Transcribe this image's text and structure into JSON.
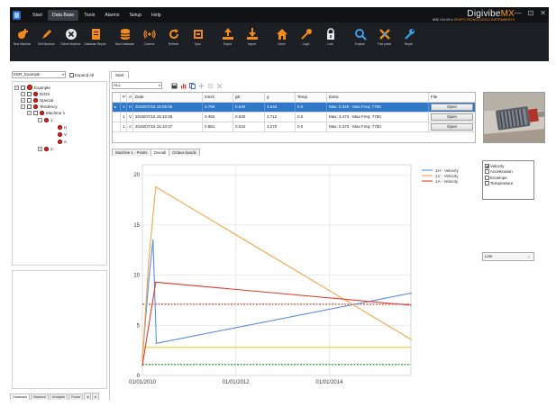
{
  "titlebar": {
    "menu": [
      "Start",
      "Data Base",
      "Tools",
      "Alarms",
      "Setup",
      "Help"
    ],
    "active_menu": "Data Base",
    "brand_name": "DigivibeMX",
    "brand_version": "M30 V10.09.4",
    "brand_maker": "GRUPO TECNOLOGICO INSTRUMENTS",
    "window_buttons": [
      "—",
      "⊡",
      "✕"
    ]
  },
  "ribbon": {
    "buttons": [
      {
        "label": "New Machine",
        "icon": "new-machine-icon"
      },
      {
        "label": "Edit Machine",
        "icon": "edit-pencil-icon"
      },
      {
        "label": "Delete Machine",
        "icon": "delete-circle-icon"
      },
      {
        "label": "Database Report",
        "icon": "database-report-icon"
      },
      {
        "label": "New Database",
        "icon": "new-database-icon"
      },
      {
        "label": "Connect",
        "icon": "connect-wireless-icon"
      },
      {
        "label": "Refresh",
        "icon": "refresh-icon"
      },
      {
        "label": "Sync",
        "icon": "sync-document-icon"
      },
      {
        "label": "Export",
        "icon": "export-icon"
      },
      {
        "label": "Import",
        "icon": "import-icon"
      },
      {
        "label": "Home",
        "icon": "home-icon"
      },
      {
        "label": "Login",
        "icon": "key-icon"
      },
      {
        "label": "Lock",
        "icon": "lock-icon"
      },
      {
        "label": "Explore",
        "icon": "search-icon"
      },
      {
        "label": "Free plane",
        "icon": "free-plane-icon"
      },
      {
        "label": "Repair",
        "icon": "wrench-icon"
      }
    ]
  },
  "left_panel": {
    "db_combo": "EDR_Example",
    "expand_all": "Expand All",
    "expand_all_checked": false,
    "tree": [
      {
        "label": "Example",
        "level": 0
      },
      {
        "label": "IDOS",
        "level": 1
      },
      {
        "label": "Special",
        "level": 1
      },
      {
        "label": "Tendency",
        "level": 1
      },
      {
        "label": "Machine 1",
        "level": 2
      },
      {
        "label": "1",
        "level": 3
      },
      {
        "label": "H",
        "level": 4
      },
      {
        "label": "V",
        "level": 4
      },
      {
        "label": "A",
        "level": 4
      },
      {
        "label": "2",
        "level": 3
      }
    ],
    "bottom_tabs": [
      "Database",
      "Balance",
      "Analysis",
      "Route",
      "◂",
      "▸"
    ]
  },
  "main": {
    "doc_tab": "Start",
    "filter_combo": "ALL",
    "grid": {
      "columns": [
        "P",
        "A",
        "Date",
        "mm/s",
        "gE",
        "g",
        "Temp",
        "Extra",
        "File"
      ],
      "rows": [
        {
          "p": "1",
          "a": "H",
          "date": "2015/07/15 15:05:05",
          "mms": "3.750",
          "ge": "0.640",
          "g": "3.543",
          "temp": "0.0",
          "extra": "Max: 0.320 - Max Freq: 7750",
          "file": "Open",
          "selected": true
        },
        {
          "p": "1",
          "a": "V",
          "date": "2015/07/15 15:10:28",
          "mms": "3.460",
          "ge": "0.030",
          "g": "3.712",
          "temp": "0.0",
          "extra": "Max: 3.473 - Max Freq: 7750",
          "file": "Open",
          "selected": false
        },
        {
          "p": "1",
          "a": "A",
          "date": "2015/07/15 15:10:37",
          "mms": "0.881",
          "ge": "0.032",
          "g": "3.270",
          "temp": "0.0",
          "extra": "Max: 0.370 - Max Freq: 7750",
          "file": "Open",
          "selected": false
        }
      ]
    },
    "sub_tabs": [
      "Machine 1 - Points",
      "Overall",
      "Octave bands"
    ],
    "active_sub_tab": "Overall",
    "params": [
      {
        "label": "Velocity",
        "checked": true
      },
      {
        "label": "Acceleration",
        "checked": false
      },
      {
        "label": "Envelope",
        "checked": false
      },
      {
        "label": "Temperature",
        "checked": false
      }
    ],
    "units_select": "Line"
  },
  "chart_data": {
    "type": "line",
    "xlabel": "",
    "ylabel": "",
    "x_ticks": [
      "01/01/2010",
      "01/01/2012",
      "01/01/2014"
    ],
    "y_ticks": [
      0,
      5,
      10,
      15,
      20
    ],
    "ylim": [
      0,
      21
    ],
    "xlim": [
      "2010-01-01",
      "2015-10-01"
    ],
    "grid": true,
    "legend_position": "top-right",
    "series": [
      {
        "name": "1H - Velocity",
        "color": "#5b8fd8",
        "x": [
          "2010-01-01",
          "2010-02-20",
          "2010-03-25",
          "2010-04-20",
          "2015-10-01"
        ],
        "values": [
          1.8,
          9.5,
          13.5,
          3.2,
          8.2
        ]
      },
      {
        "name": "1V - Velocity",
        "color": "#f5a54a",
        "x": [
          "2010-01-01",
          "2010-02-20",
          "2010-04-15",
          "2015-10-01"
        ],
        "values": [
          1.5,
          11.5,
          18.8,
          3.6
        ]
      },
      {
        "name": "1A - Velocity",
        "color": "#e0402f",
        "x": [
          "2010-01-01",
          "2010-02-20",
          "2010-04-15",
          "2015-10-01"
        ],
        "values": [
          1.0,
          5.0,
          9.3,
          7.0
        ]
      }
    ],
    "threshold_lines": [
      {
        "value": 7.1,
        "color": "#e0402f",
        "style": "dashed"
      },
      {
        "value": 2.8,
        "color": "#e6d42a",
        "style": "solid"
      },
      {
        "value": 1.1,
        "color": "#2e9a2e",
        "style": "dashed"
      }
    ]
  }
}
